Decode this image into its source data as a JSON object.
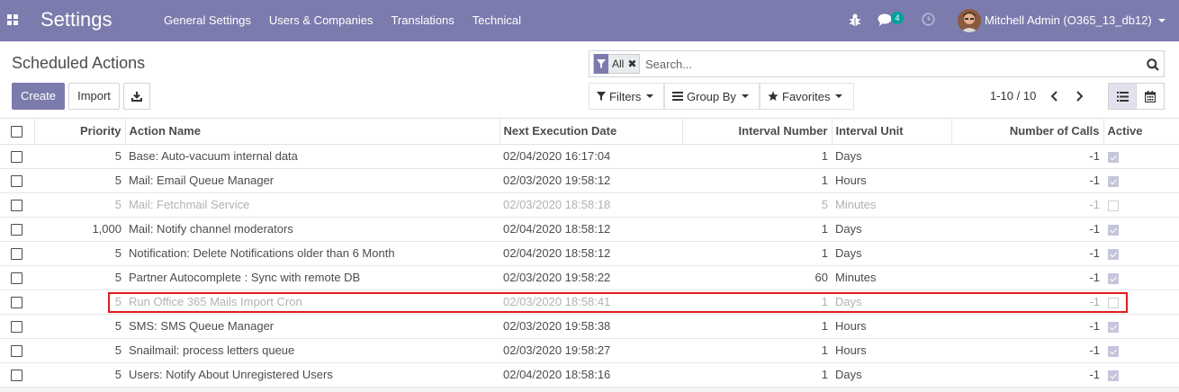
{
  "navbar": {
    "brand": "Settings",
    "menu": [
      "General Settings",
      "Users & Companies",
      "Translations",
      "Technical"
    ],
    "chat_badge": "4",
    "user": "Mitchell Admin (O365_13_db12)",
    "color": "#7c7bad"
  },
  "control_panel": {
    "title": "Scheduled Actions",
    "create_label": "Create",
    "import_label": "Import",
    "facet_value": "All",
    "search_placeholder": "Search...",
    "filters_label": "Filters",
    "groupby_label": "Group By",
    "favorites_label": "Favorites",
    "pager": "1-10 / 10"
  },
  "table": {
    "headers": {
      "priority": "Priority",
      "name": "Action Name",
      "next": "Next Execution Date",
      "interval_number": "Interval Number",
      "interval_unit": "Interval Unit",
      "calls": "Number of Calls",
      "active": "Active"
    },
    "rows": [
      {
        "priority": "5",
        "name": "Base: Auto-vacuum internal data",
        "next": "02/04/2020 16:17:04",
        "interval_number": "1",
        "interval_unit": "Days",
        "calls": "-1",
        "active": true
      },
      {
        "priority": "5",
        "name": "Mail: Email Queue Manager",
        "next": "02/03/2020 19:58:12",
        "interval_number": "1",
        "interval_unit": "Hours",
        "calls": "-1",
        "active": true
      },
      {
        "priority": "5",
        "name": "Mail: Fetchmail Service",
        "next": "02/03/2020 18:58:18",
        "interval_number": "5",
        "interval_unit": "Minutes",
        "calls": "-1",
        "active": false
      },
      {
        "priority": "1,000",
        "name": "Mail: Notify channel moderators",
        "next": "02/04/2020 18:58:12",
        "interval_number": "1",
        "interval_unit": "Days",
        "calls": "-1",
        "active": true
      },
      {
        "priority": "5",
        "name": "Notification: Delete Notifications older than 6 Month",
        "next": "02/04/2020 18:58:12",
        "interval_number": "1",
        "interval_unit": "Days",
        "calls": "-1",
        "active": true
      },
      {
        "priority": "5",
        "name": "Partner Autocomplete : Sync with remote DB",
        "next": "02/03/2020 19:58:22",
        "interval_number": "60",
        "interval_unit": "Minutes",
        "calls": "-1",
        "active": true
      },
      {
        "priority": "5",
        "name": "Run Office 365 Mails Import Cron",
        "next": "02/03/2020 18:58:41",
        "interval_number": "1",
        "interval_unit": "Days",
        "calls": "-1",
        "active": false
      },
      {
        "priority": "5",
        "name": "SMS: SMS Queue Manager",
        "next": "02/03/2020 19:58:38",
        "interval_number": "1",
        "interval_unit": "Hours",
        "calls": "-1",
        "active": true
      },
      {
        "priority": "5",
        "name": "Snailmail: process letters queue",
        "next": "02/03/2020 19:58:27",
        "interval_number": "1",
        "interval_unit": "Hours",
        "calls": "-1",
        "active": true
      },
      {
        "priority": "5",
        "name": "Users: Notify About Unregistered Users",
        "next": "02/04/2020 18:58:16",
        "interval_number": "1",
        "interval_unit": "Days",
        "calls": "-1",
        "active": true
      }
    ]
  }
}
